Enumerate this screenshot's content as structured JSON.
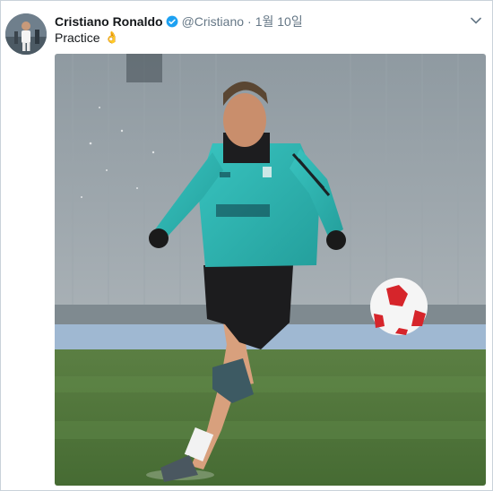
{
  "tweet": {
    "display_name": "Cristiano Ronaldo",
    "handle": "@Cristiano",
    "separator": "·",
    "date": "1월 10일",
    "text": "Practice",
    "emoji": "👌",
    "verified": true
  },
  "colors": {
    "name": "#14171a",
    "muted": "#657786",
    "verified_badge": "#1da1f2",
    "jersey": "#2fb7b4",
    "pitch": "#4f7a3a",
    "ball_red": "#d6252b"
  },
  "icons": {
    "avatar": "profile-photo",
    "verified": "verified-badge-icon",
    "menu": "chevron-down-icon",
    "media": "player-kicking-ball-photo"
  }
}
